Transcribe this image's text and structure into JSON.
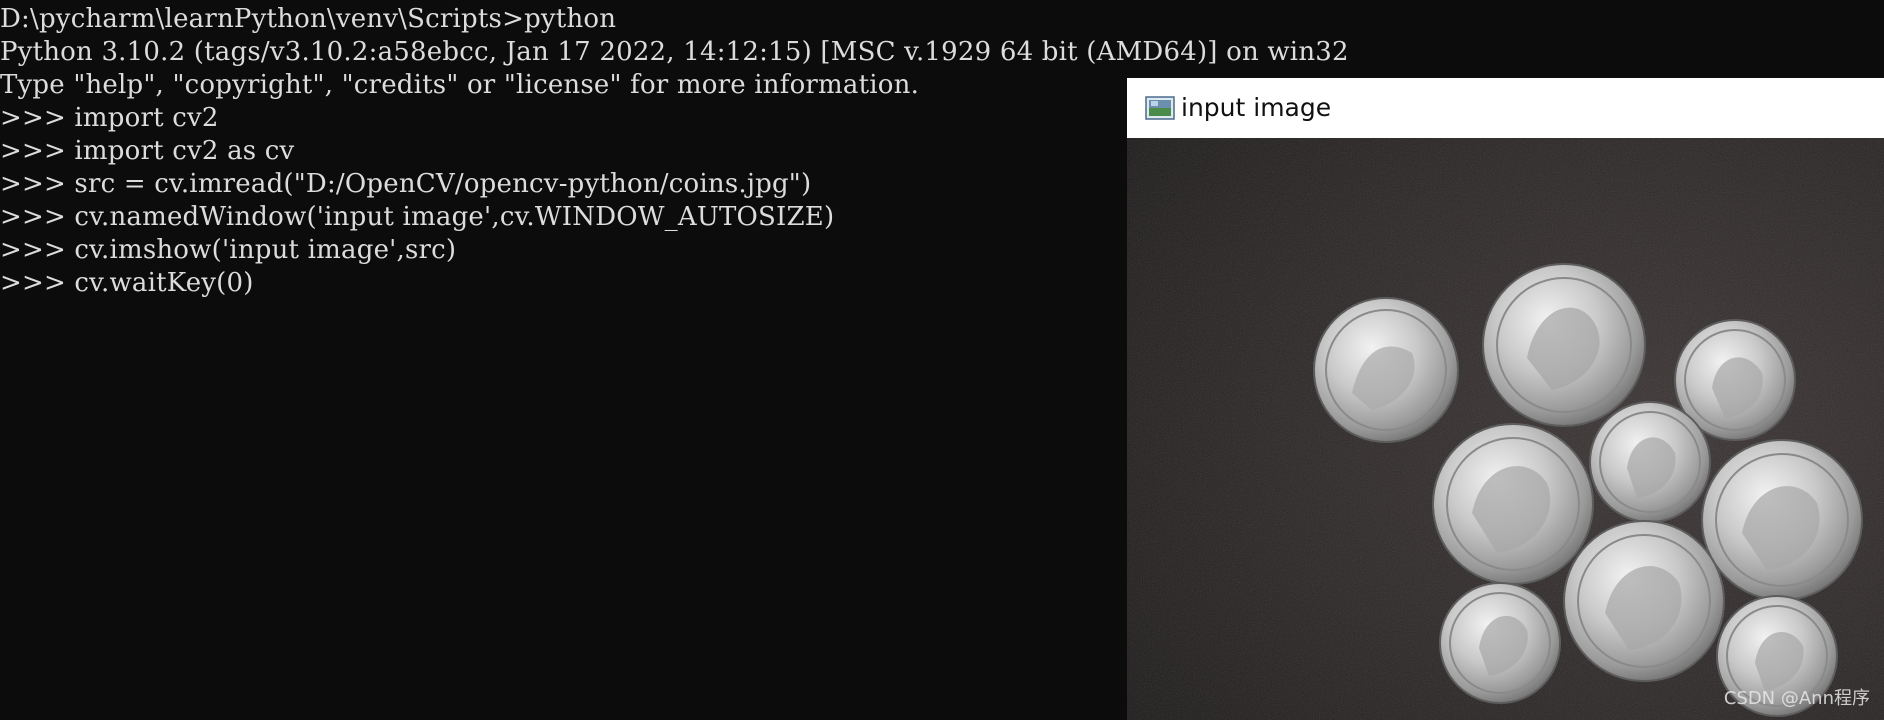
{
  "console": {
    "lines": [
      "D:\\pycharm\\learnPython\\venv\\Scripts>python",
      "Python 3.10.2 (tags/v3.10.2:a58ebcc, Jan 17 2022, 14:12:15) [MSC v.1929 64 bit (AMD64)] on win32",
      "Type \"help\", \"copyright\", \"credits\" or \"license\" for more information.",
      ">>> import cv2",
      ">>> import cv2 as cv",
      ">>> src = cv.imread(\"D:/OpenCV/opencv-python/coins.jpg\")",
      ">>> cv.namedWindow('input image',cv.WINDOW_AUTOSIZE)",
      ">>> cv.imshow('input image',src)",
      ">>> cv.waitKey(0)"
    ]
  },
  "window": {
    "title": "input image",
    "icon": "opencv-window-icon",
    "watermark": "CSDN @Ann程序"
  }
}
